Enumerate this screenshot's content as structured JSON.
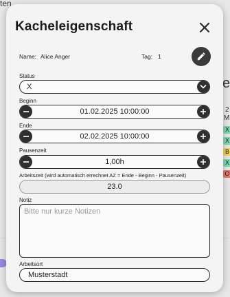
{
  "background": {
    "top_left_fragment": "ten",
    "right_fragment": "e",
    "right_num_fragment": "2",
    "right_mi_fragment": "Mi",
    "chips": [
      {
        "text": "X",
        "color": "#7fd9b0"
      },
      {
        "text": "X",
        "color": "#7fd9b0"
      },
      {
        "text": "B",
        "color": "#f2d35a"
      },
      {
        "text": "X",
        "color": "#7fd9b0"
      },
      {
        "text": "O",
        "color": "#e57a6b"
      }
    ]
  },
  "modal": {
    "title": "Kacheleigenschaft",
    "name_label": "Name:",
    "name_value": "Alice Anger",
    "day_label": "Tag:",
    "day_value": "1",
    "status": {
      "label": "Status",
      "value": "X"
    },
    "start": {
      "label": "Beginn",
      "value": "01.02.2025 10:00:00"
    },
    "end": {
      "label": "Ende",
      "value": "02.02.2025 10:00:00"
    },
    "pause": {
      "label": "Pausenzeit",
      "value": "1,00h"
    },
    "worktime": {
      "label": "Arbeitszeit (wird automatisch errechnet AZ = Ende - Beginn - Pausenzeit)",
      "value": "23.0"
    },
    "note": {
      "label": "Notiz",
      "placeholder": "Bitte nur kurze Notizen",
      "value": ""
    },
    "location": {
      "label": "Arbeitsort",
      "value": "Musterstadt"
    }
  },
  "icons": {
    "close": "close-icon",
    "edit": "pencil-icon",
    "dropdown": "chevron-down-icon",
    "decrement": "minus-icon",
    "increment": "plus-icon"
  }
}
